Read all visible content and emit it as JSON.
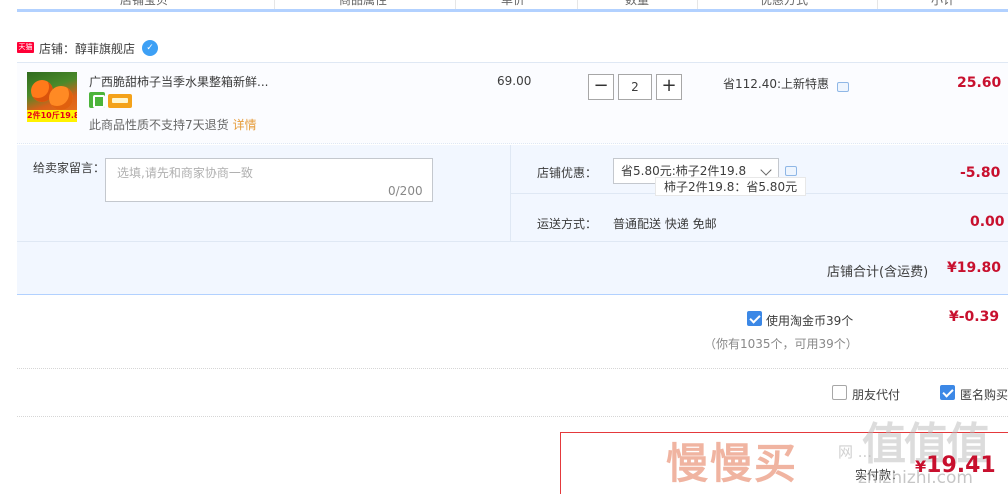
{
  "header": {
    "columns": [
      "店铺宝贝",
      "商品属性",
      "单价",
      "数量",
      "优惠方式",
      "小计"
    ]
  },
  "shop": {
    "badge": "天猫",
    "name": "店铺：醇菲旗舰店",
    "chat_icon": "wangwang-chat-icon"
  },
  "item": {
    "thumb_promo": "2件10斤19.8",
    "title": "广西脆甜柿子当季水果整箱新鲜...",
    "notice": "此商品性质不支持7天退货",
    "detail_link": "详情",
    "price": "69.00",
    "qty_minus": "−",
    "qty_value": "2",
    "qty_plus": "+",
    "discount": "省112.40:上新特惠",
    "subtotal": "25.60"
  },
  "order": {
    "memo_label": "给卖家留言：",
    "memo_placeholder": "选填,请先和商家协商一致",
    "memo_count": "0/200",
    "coupon_label": "店铺优惠：",
    "coupon_selected": "省5.80元:柿子2件19.8",
    "coupon_tooltip": "柿子2件19.8：省5.80元",
    "coupon_amount": "-5.80",
    "ship_label": "运送方式：",
    "ship_value": "普通配送 快递 免邮",
    "ship_amount": "0.00",
    "shop_total_label": "店铺合计(含运费)",
    "shop_total": "¥19.80"
  },
  "coins": {
    "checked": true,
    "label": "使用淘金币39个",
    "amount": "¥-0.39",
    "note": "（你有1035个，可用39个）"
  },
  "options": {
    "friend_pay": "朋友代付",
    "friend_checked": false,
    "anonymous": "匿名购买",
    "anonymous_checked": true
  },
  "payment": {
    "label": "实付款：",
    "currency": "¥",
    "amount": "19.41"
  },
  "watermarks": {
    "brand1": "慢慢买",
    "brand1_sub": "网 ...",
    "brand2": "值值值",
    "brand2_url": "zhizhizhi.com"
  },
  "colors": {
    "accent_red": "#c8102e",
    "header_line": "#b2d1ff",
    "panel_bg": "#f2f7ff",
    "checkbox_blue": "#3c88e6"
  }
}
